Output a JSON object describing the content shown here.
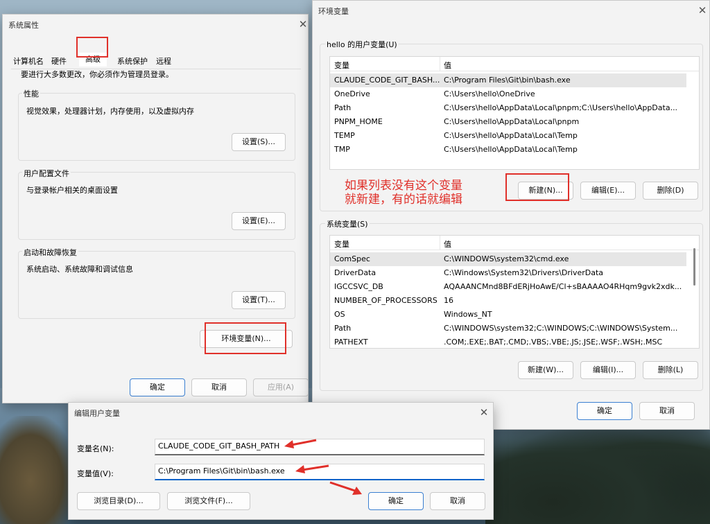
{
  "sys_props": {
    "title": "系统属性",
    "tabs": [
      "计算机名",
      "硬件",
      "高级",
      "系统保护",
      "远程"
    ],
    "notice": "要进行大多数更改，你必须作为管理员登录。",
    "performance": {
      "label": "性能",
      "desc": "视觉效果，处理器计划，内存使用，以及虚拟内存",
      "button": "设置(S)..."
    },
    "profiles": {
      "label": "用户配置文件",
      "desc": "与登录帐户相关的桌面设置",
      "button": "设置(E)..."
    },
    "startup": {
      "label": "启动和故障恢复",
      "desc": "系统启动、系统故障和调试信息",
      "button": "设置(T)..."
    },
    "env_button": "环境变量(N)...",
    "ok": "确定",
    "cancel": "取消",
    "apply": "应用(A)"
  },
  "env_vars": {
    "title": "环境变量",
    "user_group": "hello 的用户变量(U)",
    "columns": [
      "变量",
      "值"
    ],
    "user_rows": [
      {
        "name": "CLAUDE_CODE_GIT_BASH...",
        "value": "C:\\Program Files\\Git\\bin\\bash.exe"
      },
      {
        "name": "OneDrive",
        "value": "C:\\Users\\hello\\OneDrive"
      },
      {
        "name": "Path",
        "value": "C:\\Users\\hello\\AppData\\Local\\pnpm;C:\\Users\\hello\\AppData..."
      },
      {
        "name": "PNPM_HOME",
        "value": "C:\\Users\\hello\\AppData\\Local\\pnpm"
      },
      {
        "name": "TEMP",
        "value": "C:\\Users\\hello\\AppData\\Local\\Temp"
      },
      {
        "name": "TMP",
        "value": "C:\\Users\\hello\\AppData\\Local\\Temp"
      }
    ],
    "annotation_line1": "如果列表没有这个变量",
    "annotation_line2": "就新建，有的话就编辑",
    "user_new": "新建(N)...",
    "user_edit": "编辑(E)...",
    "user_delete": "删除(D)",
    "system_group": "系统变量(S)",
    "system_rows": [
      {
        "name": "ComSpec",
        "value": "C:\\WINDOWS\\system32\\cmd.exe"
      },
      {
        "name": "DriverData",
        "value": "C:\\Windows\\System32\\Drivers\\DriverData"
      },
      {
        "name": "IGCCSVC_DB",
        "value": "AQAAANCMnd8BFdERjHoAwE/Cl+sBAAAAO4RHqm9gvk2xdk..."
      },
      {
        "name": "NUMBER_OF_PROCESSORS",
        "value": "16"
      },
      {
        "name": "OS",
        "value": "Windows_NT"
      },
      {
        "name": "Path",
        "value": "C:\\WINDOWS\\system32;C:\\WINDOWS;C:\\WINDOWS\\System..."
      },
      {
        "name": "PATHEXT",
        "value": ".COM;.EXE;.BAT;.CMD;.VBS;.VBE;.JS;.JSE;.WSF;.WSH;.MSC"
      }
    ],
    "sys_new": "新建(W)...",
    "sys_edit": "编辑(I)...",
    "sys_delete": "删除(L)",
    "ok": "确定",
    "cancel": "取消"
  },
  "edit_var": {
    "title": "编辑用户变量",
    "name_label": "变量名(N):",
    "name_value": "CLAUDE_CODE_GIT_BASH_PATH",
    "value_label": "变量值(V):",
    "value_value": "C:\\Program Files\\Git\\bin\\bash.exe",
    "browse_dir": "浏览目录(D)...",
    "browse_file": "浏览文件(F)...",
    "ok": "确定",
    "cancel": "取消"
  },
  "icons": {
    "close": "close-icon"
  },
  "colors": {
    "annotation": "#e0302a",
    "focus": "#0b63c9"
  }
}
